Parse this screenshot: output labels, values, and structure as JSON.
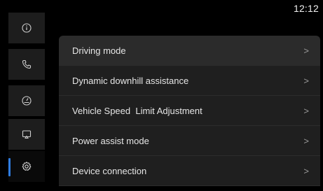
{
  "status_bar": {
    "time": "12:12"
  },
  "sidebar": {
    "items": [
      {
        "icon": "info-icon",
        "active": false
      },
      {
        "icon": "phone-icon",
        "active": false
      },
      {
        "icon": "gauge-icon",
        "active": false
      },
      {
        "icon": "screen-cast-icon",
        "active": false
      },
      {
        "icon": "gear-icon",
        "active": true
      }
    ],
    "accent_color": "#2f7de1"
  },
  "menu": {
    "items": [
      {
        "label": "Driving mode",
        "chevron": ">"
      },
      {
        "label": "Dynamic downhill assistance",
        "chevron": ">"
      },
      {
        "label": "Vehicle Speed  Limit Adjustment",
        "chevron": ">"
      },
      {
        "label": "Power assist mode",
        "chevron": ">"
      },
      {
        "label": "Device connection",
        "chevron": ">"
      }
    ]
  }
}
